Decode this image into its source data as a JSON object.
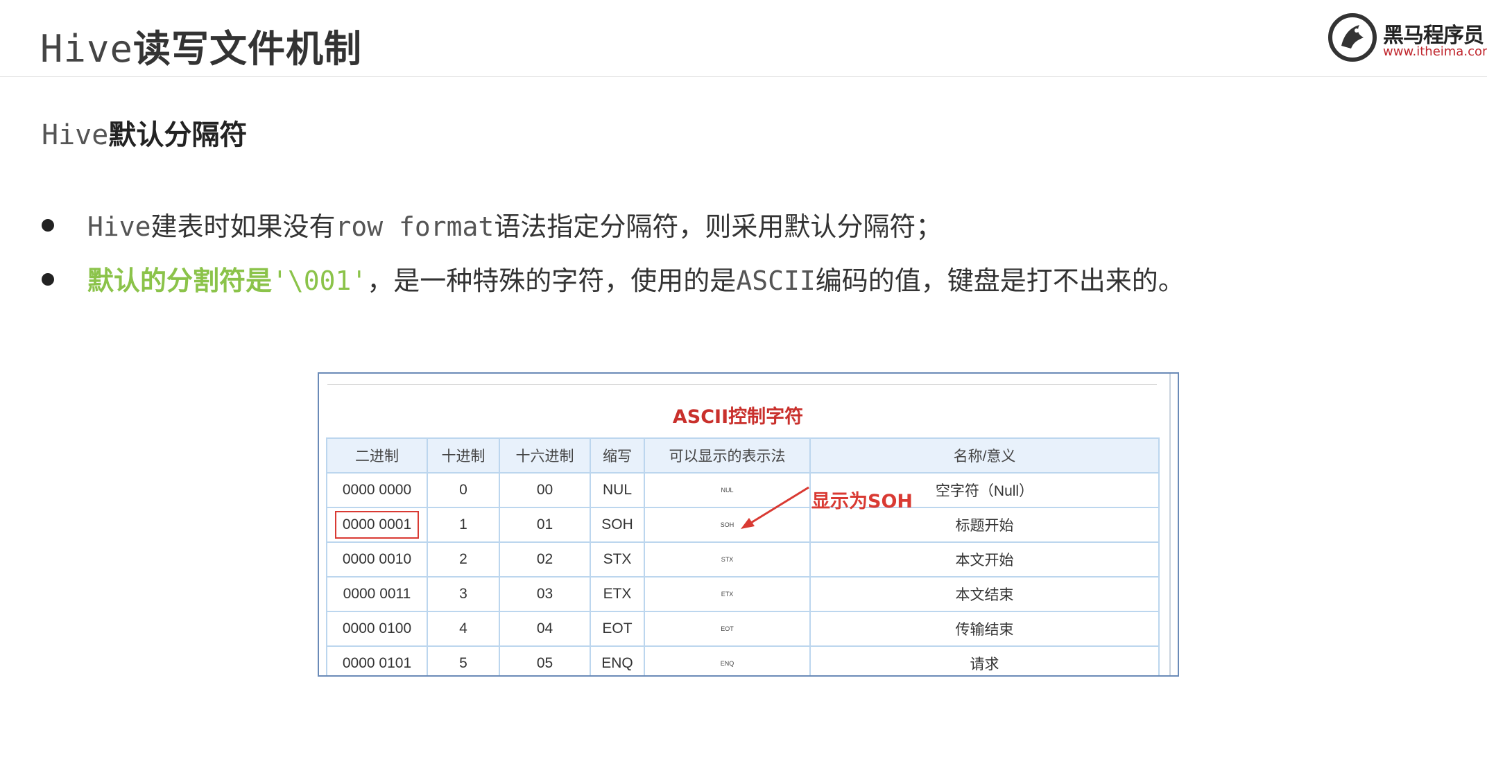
{
  "header": {
    "title_prefix": "Hive",
    "title_suffix": "读写文件机制",
    "logo_text": "黑马程序员",
    "logo_url": "www.itheima.com"
  },
  "section": {
    "title_prefix": "Hive",
    "title_suffix": "默认分隔符"
  },
  "bullets": [
    {
      "p1": "Hive",
      "p2": "建表时如果没有",
      "p3": "row format",
      "p4": "语法指定分隔符，则采用默认分隔符；"
    },
    {
      "p1": "默认的分割符是",
      "p2": "'\\001'",
      "p3": "，是一种特殊的字符，使用的是",
      "p4": "ASCII",
      "p5": "编码的值，键盘是打不出来的。"
    }
  ],
  "colors": {
    "accent_green": "#8bc34a",
    "accent_red": "#d93a33",
    "table_border": "#bcd6ee",
    "table_header_bg": "#e8f1fb"
  },
  "figure": {
    "title": "ASCII控制字符",
    "annotation": "显示为SOH",
    "columns": [
      "二进制",
      "十进制",
      "十六进制",
      "缩写",
      "可以显示的表示法",
      "名称/意义"
    ],
    "rows": [
      [
        "0000 0000",
        "0",
        "00",
        "NUL",
        "NUL",
        "空字符（Null）"
      ],
      [
        "0000 0001",
        "1",
        "01",
        "SOH",
        "SOH",
        "标题开始"
      ],
      [
        "0000 0010",
        "2",
        "02",
        "STX",
        "STX",
        "本文开始"
      ],
      [
        "0000 0011",
        "3",
        "03",
        "ETX",
        "ETX",
        "本文结束"
      ],
      [
        "0000 0100",
        "4",
        "04",
        "EOT",
        "EOT",
        "传输结束"
      ],
      [
        "0000 0101",
        "5",
        "05",
        "ENQ",
        "ENQ",
        "请求"
      ]
    ]
  }
}
